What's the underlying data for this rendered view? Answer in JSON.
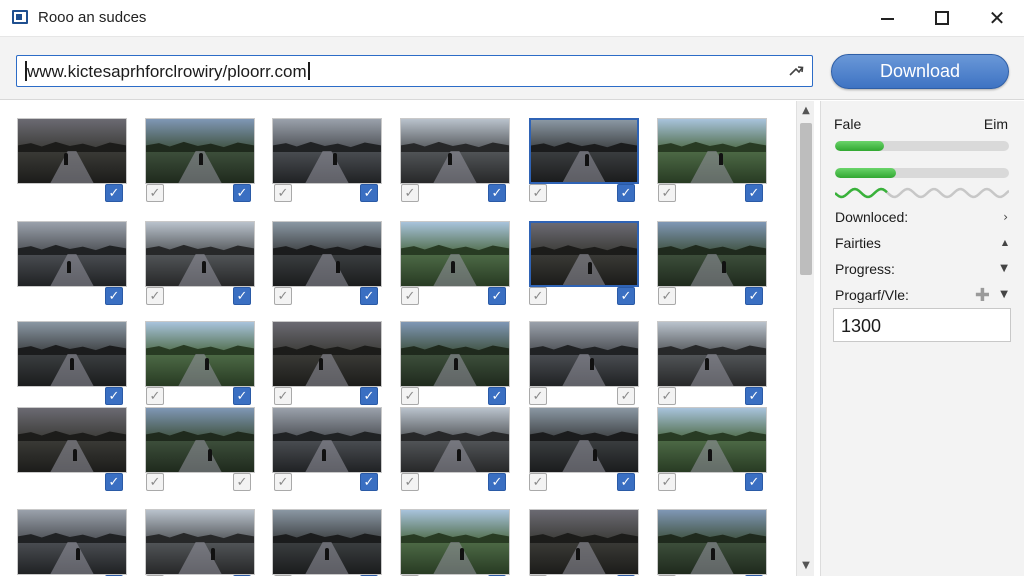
{
  "window": {
    "title": "Rooo an sudces"
  },
  "address_bar": {
    "url": "www.kictesaprhforclrowiry/ploorr.com"
  },
  "toolbar": {
    "download_label": "Download"
  },
  "panel": {
    "header_left": "Fale",
    "header_right": "Eim",
    "progress_bars": [
      {
        "fill": 0.28
      },
      {
        "fill": 0.35
      },
      {
        "fill": 0.3
      }
    ],
    "rows": [
      {
        "label": "Downloced:",
        "control": "chevron-right"
      },
      {
        "label": "Fairties",
        "control": "triangle-up"
      },
      {
        "label": "Progress:",
        "control": "dropdown"
      },
      {
        "label": "Progarf/Vle:",
        "control": "plus-dropdown"
      }
    ],
    "value": "1300"
  },
  "gallery": {
    "columns": 6,
    "rows": 5,
    "checked": [
      [
        true,
        true,
        true,
        true,
        true,
        true
      ],
      [
        true,
        true,
        true,
        true,
        true,
        true
      ],
      [
        true,
        true,
        true,
        true,
        false,
        true
      ],
      [
        true,
        false,
        true,
        true,
        true,
        true
      ],
      [
        true,
        true,
        true,
        true,
        true,
        true
      ]
    ],
    "selected": [
      [
        false,
        false,
        false,
        false,
        true,
        false
      ],
      [
        false,
        false,
        false,
        false,
        true,
        false
      ],
      [
        false,
        false,
        false,
        false,
        false,
        false
      ],
      [
        false,
        false,
        false,
        false,
        false,
        false
      ],
      [
        false,
        false,
        false,
        false,
        false,
        false
      ]
    ],
    "themes": [
      [
        "#6b6a72",
        "#3a3a36",
        "#1c1c1a"
      ],
      [
        "#7f97b5",
        "#3d4f3b",
        "#1f2a1d"
      ],
      [
        "#9aa1ab",
        "#4a4d52",
        "#202224"
      ],
      [
        "#b9c2cc",
        "#525558",
        "#272829"
      ],
      [
        "#8a97a3",
        "#3b3e40",
        "#1b1c1d"
      ],
      [
        "#a8c3dc",
        "#4d6a46",
        "#283b23"
      ]
    ]
  }
}
